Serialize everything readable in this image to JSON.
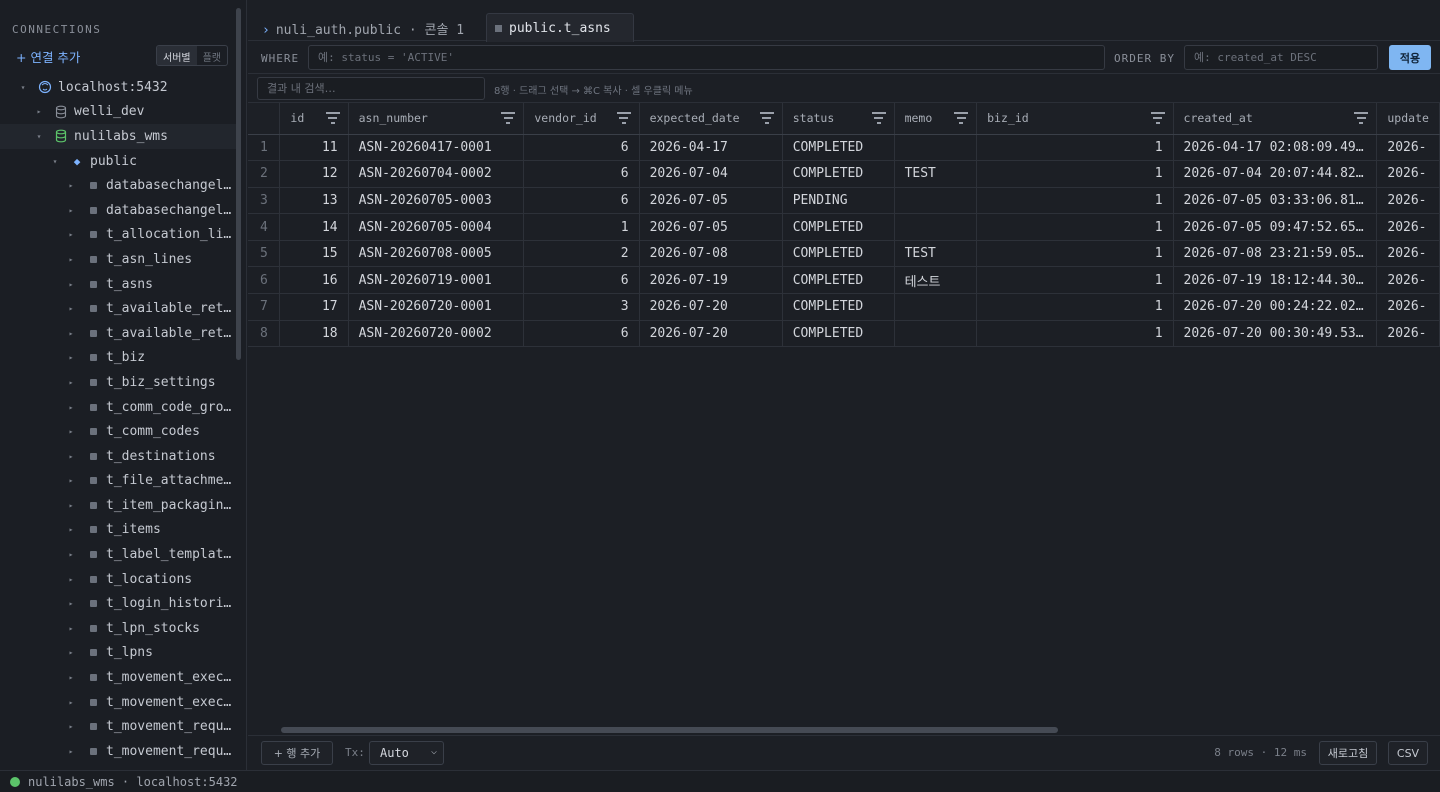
{
  "sidebar": {
    "title": "CONNECTIONS",
    "add_label": "+ 연결 추가",
    "toggle": [
      "서버별",
      "플랫"
    ],
    "tree": [
      {
        "label": "localhost:5432",
        "level": 0,
        "kind": "server",
        "expanded": true
      },
      {
        "label": "welli_dev",
        "level": 1,
        "kind": "db",
        "expanded": false
      },
      {
        "label": "nulilabs_wms",
        "level": 1,
        "kind": "db-active",
        "expanded": true,
        "selected": true
      },
      {
        "label": "public",
        "level": 2,
        "kind": "schema",
        "expanded": true
      },
      {
        "label": "databasechangel…",
        "level": 3,
        "kind": "table"
      },
      {
        "label": "databasechangel…",
        "level": 3,
        "kind": "table"
      },
      {
        "label": "t_allocation_li…",
        "level": 3,
        "kind": "table"
      },
      {
        "label": "t_asn_lines",
        "level": 3,
        "kind": "table"
      },
      {
        "label": "t_asns",
        "level": 3,
        "kind": "table"
      },
      {
        "label": "t_available_ret…",
        "level": 3,
        "kind": "table"
      },
      {
        "label": "t_available_ret…",
        "level": 3,
        "kind": "table"
      },
      {
        "label": "t_biz",
        "level": 3,
        "kind": "table"
      },
      {
        "label": "t_biz_settings",
        "level": 3,
        "kind": "table"
      },
      {
        "label": "t_comm_code_gro…",
        "level": 3,
        "kind": "table"
      },
      {
        "label": "t_comm_codes",
        "level": 3,
        "kind": "table"
      },
      {
        "label": "t_destinations",
        "level": 3,
        "kind": "table"
      },
      {
        "label": "t_file_attachme…",
        "level": 3,
        "kind": "table"
      },
      {
        "label": "t_item_packagin…",
        "level": 3,
        "kind": "table"
      },
      {
        "label": "t_items",
        "level": 3,
        "kind": "table"
      },
      {
        "label": "t_label_templat…",
        "level": 3,
        "kind": "table"
      },
      {
        "label": "t_locations",
        "level": 3,
        "kind": "table"
      },
      {
        "label": "t_login_histori…",
        "level": 3,
        "kind": "table"
      },
      {
        "label": "t_lpn_stocks",
        "level": 3,
        "kind": "table"
      },
      {
        "label": "t_lpns",
        "level": 3,
        "kind": "table"
      },
      {
        "label": "t_movement_exec…",
        "level": 3,
        "kind": "table"
      },
      {
        "label": "t_movement_exec…",
        "level": 3,
        "kind": "table"
      },
      {
        "label": "t_movement_requ…",
        "level": 3,
        "kind": "table"
      },
      {
        "label": "t_movement_requ…",
        "level": 3,
        "kind": "table"
      }
    ]
  },
  "tabs": {
    "console": "nuli_auth.public · 콘솔 1",
    "active": "public.t_asns"
  },
  "filter": {
    "where_label": "WHERE",
    "where_placeholder": "예: status = 'ACTIVE'",
    "order_label": "ORDER BY",
    "order_placeholder": "예: created_at DESC",
    "apply_label": "적용"
  },
  "search": {
    "placeholder": "결과 내 검색…",
    "hint": "8행 · 드래그 선택 → ⌘C 복사 · 셀 우클릭 메뉴"
  },
  "grid": {
    "columns": [
      "id",
      "asn_number",
      "vendor_id",
      "expected_date",
      "status",
      "memo",
      "biz_id",
      "created_at",
      "update"
    ],
    "rows": [
      [
        "1",
        "11",
        "ASN-20260417-0001",
        "6",
        "2026-04-17",
        "COMPLETED",
        "",
        "1",
        "2026-04-17 02:08:09.49…",
        "2026-"
      ],
      [
        "2",
        "12",
        "ASN-20260704-0002",
        "6",
        "2026-07-04",
        "COMPLETED",
        "TEST",
        "1",
        "2026-07-04 20:07:44.82…",
        "2026-"
      ],
      [
        "3",
        "13",
        "ASN-20260705-0003",
        "6",
        "2026-07-05",
        "PENDING",
        "",
        "1",
        "2026-07-05 03:33:06.81…",
        "2026-"
      ],
      [
        "4",
        "14",
        "ASN-20260705-0004",
        "1",
        "2026-07-05",
        "COMPLETED",
        "",
        "1",
        "2026-07-05 09:47:52.65…",
        "2026-"
      ],
      [
        "5",
        "15",
        "ASN-20260708-0005",
        "2",
        "2026-07-08",
        "COMPLETED",
        "TEST",
        "1",
        "2026-07-08 23:21:59.05…",
        "2026-"
      ],
      [
        "6",
        "16",
        "ASN-20260719-0001",
        "6",
        "2026-07-19",
        "COMPLETED",
        "테스트",
        "1",
        "2026-07-19 18:12:44.30…",
        "2026-"
      ],
      [
        "7",
        "17",
        "ASN-20260720-0001",
        "3",
        "2026-07-20",
        "COMPLETED",
        "",
        "1",
        "2026-07-20 00:24:22.02…",
        "2026-"
      ],
      [
        "8",
        "18",
        "ASN-20260720-0002",
        "6",
        "2026-07-20",
        "COMPLETED",
        "",
        "1",
        "2026-07-20 00:30:49.53…",
        "2026-"
      ]
    ]
  },
  "footer": {
    "add_row": "+ 행 추가",
    "tx_label": "Tx:",
    "tx_value": "Auto",
    "rows_info": "8 rows · 12 ms",
    "refresh": "새로고침",
    "csv": "CSV"
  },
  "statusbar": {
    "text": "nulilabs_wms · localhost:5432",
    "dot_color": "#5cc46a"
  }
}
